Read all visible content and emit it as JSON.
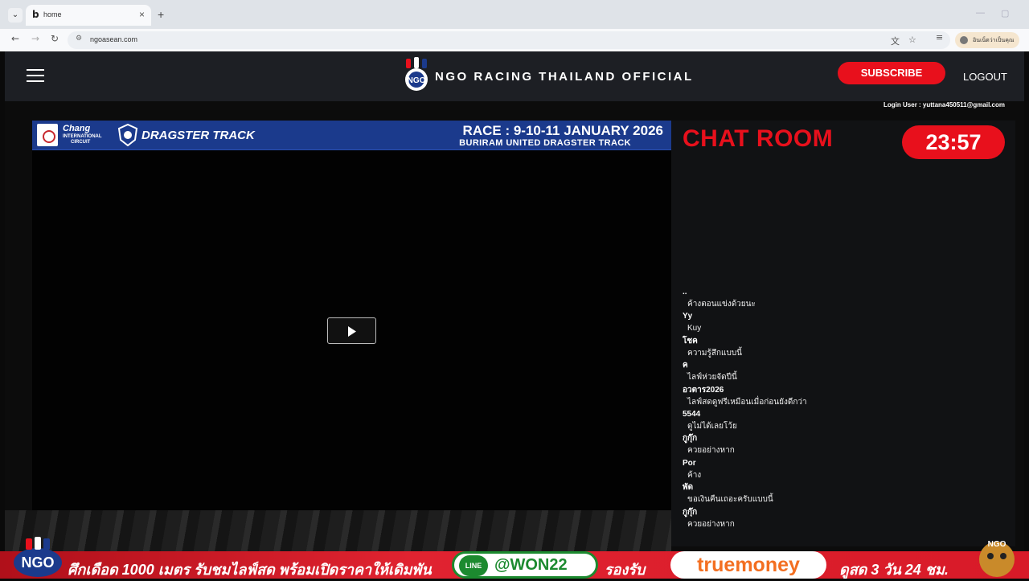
{
  "browser": {
    "tab_favicon": "b",
    "tab_title": "home",
    "tab_close": "×",
    "new_tab": "+",
    "dropdown": "⌄",
    "url": "ngoasean.com",
    "profile_label": "อินเน็ตว่าเป็นคุณ",
    "window_minimize": "—",
    "window_restore": "▢"
  },
  "header": {
    "brand_title": "NGO RACING THAILAND OFFICIAL",
    "subscribe_label": "SUBSCRIBE",
    "logout_label": "LOGOUT",
    "login_user": "Login User : yuttana450511@gmail.com"
  },
  "banner": {
    "chang": "Chang",
    "circuit_line1": "INTERNATIONAL",
    "circuit_line2": "CIRCUIT",
    "dragster": "DRAGSTER TRACK",
    "race_title": "RACE : 9-10-11 JANUARY 2026",
    "race_subtitle": "BURIRAM UNITED DRAGSTER TRACK"
  },
  "chat": {
    "title": "CHAT ROOM",
    "timer": "23:57",
    "messages": [
      {
        "user": "..",
        "text": "ค้างตอนแข่งด้วยนะ"
      },
      {
        "user": "Yy",
        "text": "Kuy"
      },
      {
        "user": "โชค",
        "text": "ความรู้สึกแบบนี้"
      },
      {
        "user": "ค",
        "text": "ไลฟ์ห่วยจัดปีนี้"
      },
      {
        "user": "อวตาร2026",
        "text": "ไลฟ์สดดูฟรีเหมือนเมื่อก่อนยังดีกว่า"
      },
      {
        "user": "5544",
        "text": "ดูไม่ได้เลยโว้ย"
      },
      {
        "user": "กูกุ๊ก",
        "text": "ควยอย่างหาก"
      },
      {
        "user": "Por",
        "text": "ค้าง"
      },
      {
        "user": "พัด",
        "text": "ขอเงินคืนเถอะครับแบบนี้"
      },
      {
        "user": "กูกุ๊ก",
        "text": "ควยอย่างหาก"
      }
    ]
  },
  "ad": {
    "text1": "ศึกเดือด 1000 เมตร รับชมไลฟ์สด พร้อมเปิดราคาให้เดิมพัน",
    "line_badge": "LINE",
    "line_id": "@WON22",
    "text2": "รองรับ",
    "truemoney": "truemoney",
    "text3": "ดูสด 3 วัน 24 ชม."
  },
  "colors": {
    "accent_red": "#e8101c",
    "header_bg": "#1d1f24",
    "banner_blue": "#1b3a8c"
  }
}
